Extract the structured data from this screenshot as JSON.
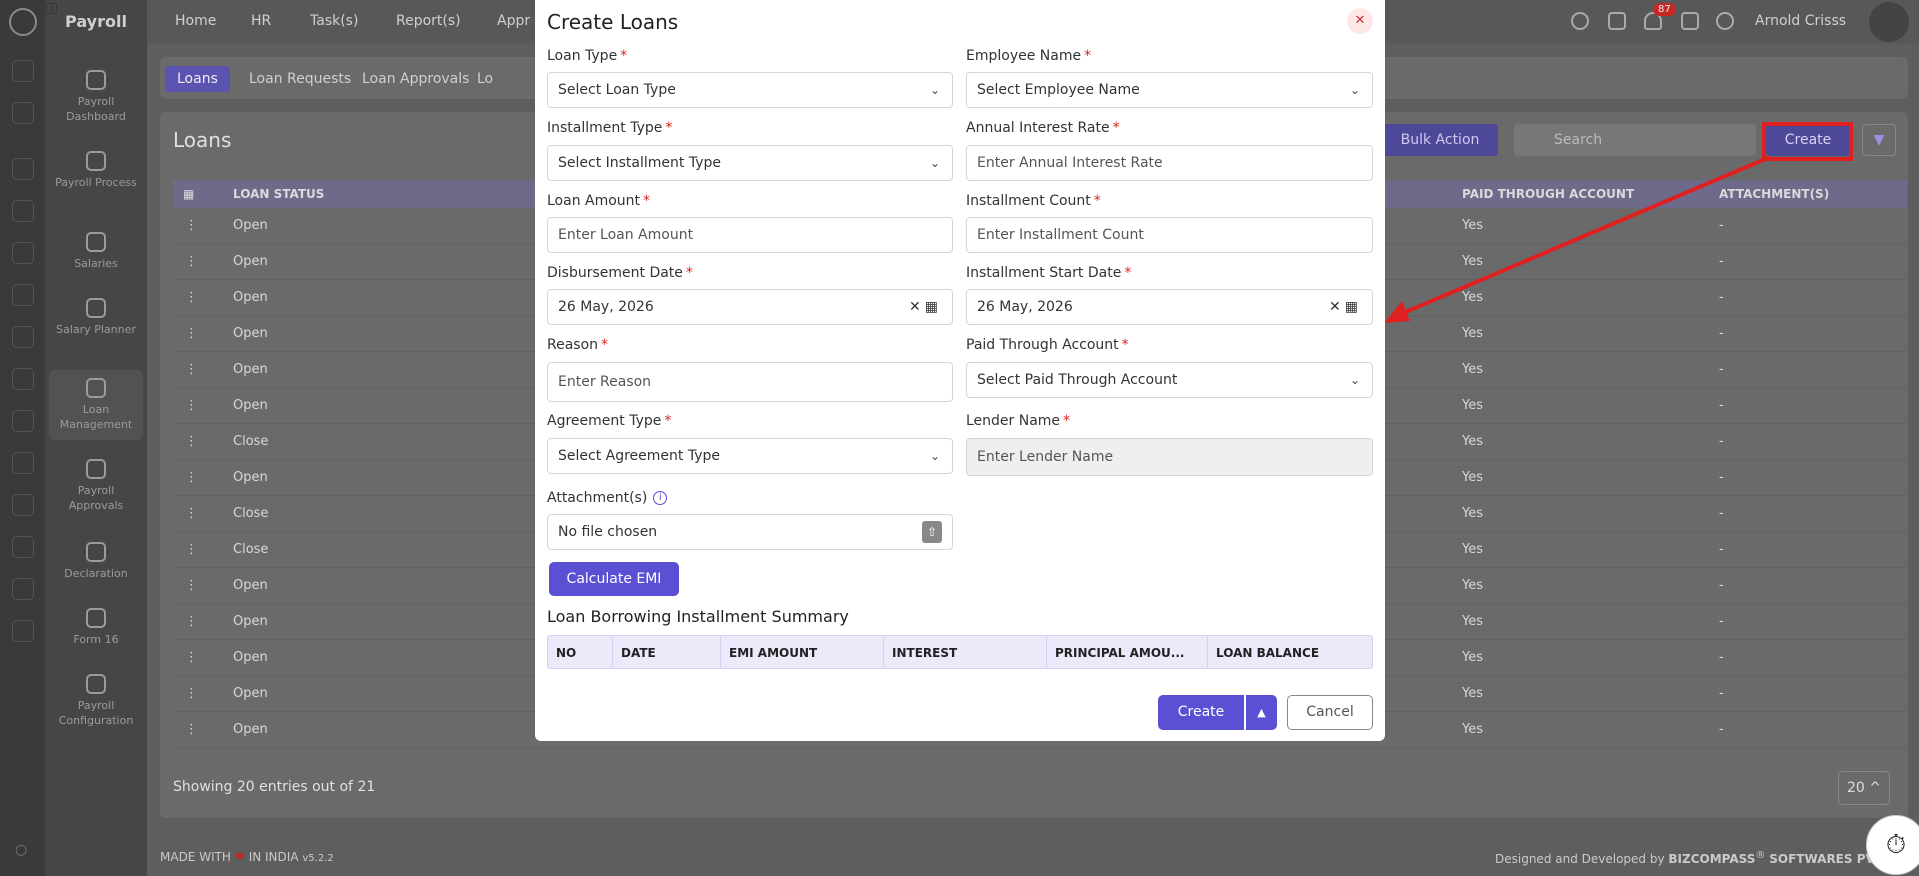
{
  "app": {
    "brand": "Payroll",
    "user_name": "Arnold Crisss",
    "notification_count": "87"
  },
  "topnav": [
    "Home",
    "HR",
    "Task(s)",
    "Report(s)",
    "Appr"
  ],
  "sidebar": [
    {
      "label": "Payroll Dashboard",
      "icon": "dashboard-icon"
    },
    {
      "label": "Payroll Process",
      "icon": "process-icon"
    },
    {
      "label": "Salaries",
      "icon": "salaries-icon"
    },
    {
      "label": "Salary Planner",
      "icon": "planner-icon"
    },
    {
      "label": "Loan Management",
      "icon": "loan-icon",
      "active": true
    },
    {
      "label": "Payroll Approvals",
      "icon": "approvals-icon"
    },
    {
      "label": "Declaration",
      "icon": "gear-icon"
    },
    {
      "label": "Form 16",
      "icon": "form-icon"
    },
    {
      "label": "Payroll Configuration",
      "icon": "gear-icon"
    }
  ],
  "subtabs": [
    "Loans",
    "Loan Requests",
    "Loan Approvals",
    "Lo"
  ],
  "page": {
    "title": "Loans",
    "bulk_action": "Bulk Action",
    "search_placeholder": "Search",
    "create_label": "Create",
    "columns": [
      "LOAN STATUS",
      "PAID THROUGH ACCOUNT",
      "ATTACHMENT(S)"
    ],
    "rows": [
      {
        "status": "Open",
        "paid": "Yes",
        "attach": "-"
      },
      {
        "status": "Open",
        "paid": "Yes",
        "attach": "-"
      },
      {
        "status": "Open",
        "paid": "Yes",
        "attach": "-"
      },
      {
        "status": "Open",
        "paid": "Yes",
        "attach": "-"
      },
      {
        "status": "Open",
        "paid": "Yes",
        "attach": "-"
      },
      {
        "status": "Open",
        "paid": "Yes",
        "attach": "-"
      },
      {
        "status": "Close",
        "paid": "Yes",
        "attach": "-"
      },
      {
        "status": "Open",
        "paid": "Yes",
        "attach": "-"
      },
      {
        "status": "Close",
        "paid": "Yes",
        "attach": "-"
      },
      {
        "status": "Close",
        "paid": "Yes",
        "attach": "-"
      },
      {
        "status": "Open",
        "paid": "Yes",
        "attach": "-"
      },
      {
        "status": "Open",
        "paid": "Yes",
        "attach": "-"
      },
      {
        "status": "Open",
        "paid": "Yes",
        "attach": "-"
      },
      {
        "status": "Open",
        "paid": "Yes",
        "attach": "-"
      },
      {
        "status": "Open",
        "paid": "Yes",
        "attach": "-"
      }
    ],
    "showing": "Showing 20 entries out of 21",
    "page_size": "20"
  },
  "footer": {
    "made_with": "MADE WITH",
    "in_india": "IN INDIA",
    "version": "v5.2.2",
    "designed": "Designed and Developed by",
    "company": "BIZCOMPASS",
    "company_suffix": "SOFTWARES PV"
  },
  "modal": {
    "title": "Create Loans",
    "loan_type": {
      "label": "Loan Type",
      "value": "Select Loan Type"
    },
    "employee_name": {
      "label": "Employee Name",
      "value": "Select Employee Name"
    },
    "installment_type": {
      "label": "Installment Type",
      "value": "Select Installment Type"
    },
    "annual_interest_rate": {
      "label": "Annual Interest Rate",
      "placeholder": "Enter Annual Interest Rate"
    },
    "loan_amount": {
      "label": "Loan Amount",
      "placeholder": "Enter Loan Amount"
    },
    "installment_count": {
      "label": "Installment Count",
      "placeholder": "Enter Installment Count"
    },
    "disbursement_date": {
      "label": "Disbursement Date",
      "value": "26 May, 2026"
    },
    "installment_start_date": {
      "label": "Installment Start Date",
      "value": "26 May, 2026"
    },
    "reason": {
      "label": "Reason",
      "placeholder": "Enter Reason"
    },
    "paid_through_account": {
      "label": "Paid Through Account",
      "value": "Select Paid Through Account"
    },
    "agreement_type": {
      "label": "Agreement Type",
      "value": "Select Agreement Type"
    },
    "lender_name": {
      "label": "Lender Name",
      "placeholder": "Enter Lender Name"
    },
    "attachments": {
      "label": "Attachment(s)",
      "value": "No file chosen"
    },
    "calculate_emi": "Calculate EMI",
    "summary_title": "Loan Borrowing Installment Summary",
    "summary_columns": [
      "NO",
      "DATE",
      "EMI AMOUNT",
      "INTEREST",
      "PRINCIPAL AMOU...",
      "LOAN BALANCE"
    ],
    "create": "Create",
    "cancel": "Cancel"
  },
  "colors": {
    "accent": "#5b4fd3",
    "required": "#e02020",
    "highlight": "#e02020"
  }
}
